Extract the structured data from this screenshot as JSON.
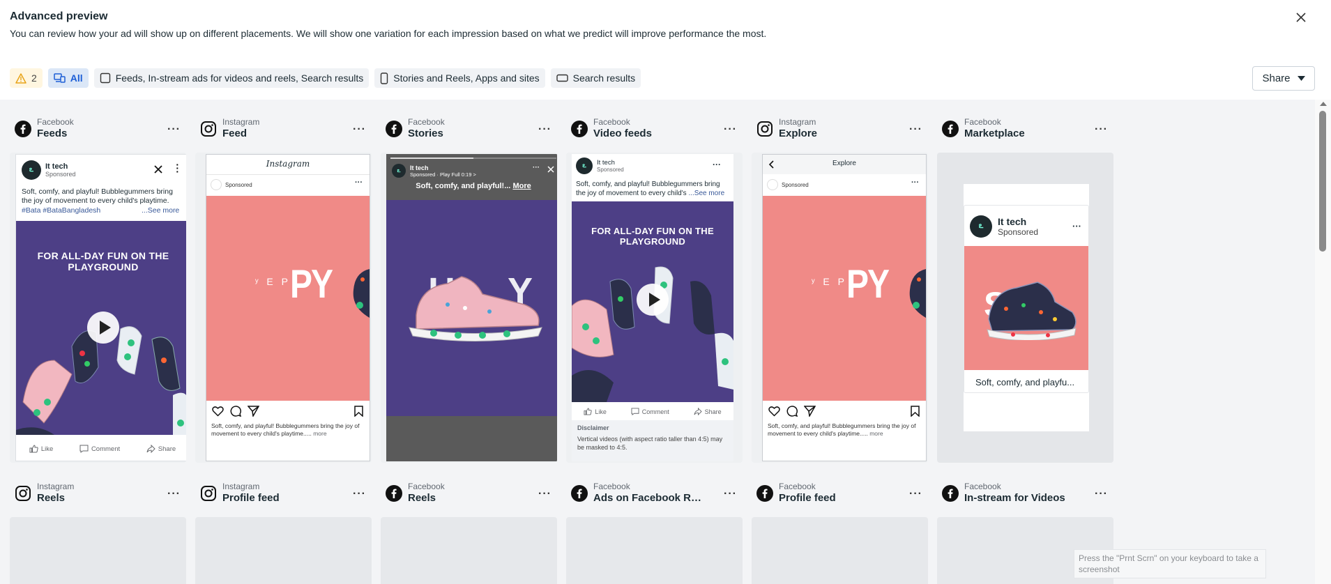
{
  "header": {
    "title": "Advanced preview",
    "subtitle": "You can review how your ad will show up on different placements. We will show one variation for each impression based on what we predict will improve performance the most."
  },
  "filters": {
    "warning_count": "2",
    "all_label": "All",
    "feeds_label": "Feeds, In-stream ads for videos and reels, Search results",
    "stories_label": "Stories and Reels, Apps and sites",
    "search_label": "Search results"
  },
  "share_label": "Share",
  "ad": {
    "page_name": "It tech",
    "sponsored": "Sponsored",
    "primary_text": "Soft, comfy, and playful! Bubblegummers bring the joy of movement to every child's playtime.",
    "hashtags": "#Bata #BataBangladesh",
    "see_more": "...See more",
    "headline": "FOR ALL-DAY FUN ON THE PLAYGROUND",
    "happy_text": "PY",
    "happy_small": "ʸ E P",
    "snappy_text": "SN",
    "like": "Like",
    "comment": "Comment",
    "share": "Share",
    "ig_logo": "Instagram",
    "ig_caption": "Soft, comfy, and playful! Bubblegummers bring the joy of movement to every child's playtime.....",
    "ig_more": "more",
    "story_sub": "Sponsored · Play Full 0:19 >",
    "story_text": "Soft, comfy, and playful!...",
    "story_more": "More",
    "video_text_1": "Soft, comfy, and playful! Bubblegummers bring the joy of movement to every child's",
    "video_see_more": "...See more",
    "disclaimer_title": "Disclaimer",
    "disclaimer_text": "Vertical videos (with aspect ratio taller than 4:5) may be masked to 4:5.",
    "explore_title": "Explore",
    "marketplace_text": "Soft, comfy, and playfu..."
  },
  "cards_row1": [
    {
      "platform": "Facebook",
      "placement": "Feeds",
      "icon": "facebook-icon"
    },
    {
      "platform": "Instagram",
      "placement": "Feed",
      "icon": "instagram-icon"
    },
    {
      "platform": "Facebook",
      "placement": "Stories",
      "icon": "facebook-icon"
    },
    {
      "platform": "Facebook",
      "placement": "Video feeds",
      "icon": "facebook-icon"
    },
    {
      "platform": "Instagram",
      "placement": "Explore",
      "icon": "instagram-icon"
    },
    {
      "platform": "Facebook",
      "placement": "Marketplace",
      "icon": "facebook-icon"
    }
  ],
  "cards_row2": [
    {
      "platform": "Instagram",
      "placement": "Reels",
      "icon": "instagram-icon"
    },
    {
      "platform": "Instagram",
      "placement": "Profile feed",
      "icon": "instagram-icon"
    },
    {
      "platform": "Facebook",
      "placement": "Reels",
      "icon": "facebook-icon"
    },
    {
      "platform": "Facebook",
      "placement": "Ads on Facebook Re...",
      "icon": "facebook-icon"
    },
    {
      "platform": "Facebook",
      "placement": "Profile feed",
      "icon": "facebook-icon"
    },
    {
      "platform": "Facebook",
      "placement": "In-stream for Videos",
      "icon": "facebook-icon"
    }
  ],
  "screenshot_tip": "Press the \"Prnt Scrn\" on your keyboard to take a screenshot",
  "colors": {
    "accent": "#1c5ed6",
    "ad_purple": "#4d3f86",
    "ad_pink": "#f08a87",
    "warning": "#e8a317"
  }
}
